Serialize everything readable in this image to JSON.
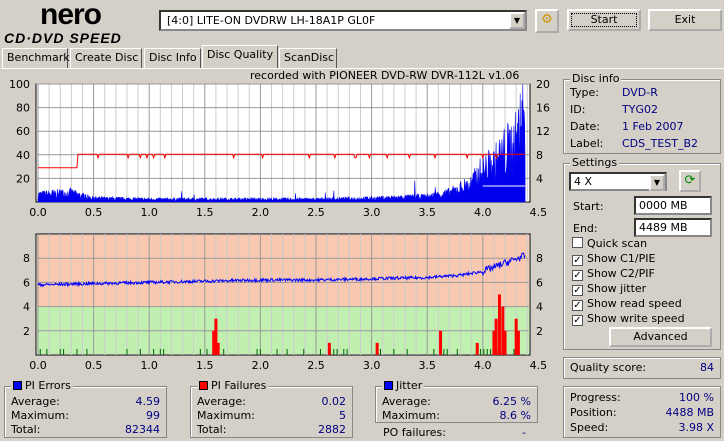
{
  "app": {
    "logo_top": "nero",
    "logo_bottom": "CD·DVD SPEED"
  },
  "toolbar": {
    "drive": "[4:0]  LITE-ON DVDRW LH-18A1P GL0F",
    "start": "Start",
    "exit": "Exit"
  },
  "tabs": [
    "Benchmark",
    "Create Disc",
    "Disc Info",
    "Disc Quality",
    "ScanDisc"
  ],
  "active_tab": "Disc Quality",
  "chart_title": "recorded with PIONEER DVD-RW  DVR-112L v1.06",
  "disc_info": {
    "title": "Disc info",
    "type_label": "Type:",
    "type": "DVD-R",
    "id_label": "ID:",
    "id": "TYG02",
    "date_label": "Date:",
    "date": "1 Feb 2007",
    "label_label": "Label:",
    "label": "CDS_TEST_B2"
  },
  "settings": {
    "title": "Settings",
    "speed": "4 X",
    "start_label": "Start:",
    "start": "0000 MB",
    "end_label": "End:",
    "end": "4489 MB",
    "checks": [
      {
        "label": "Quick scan",
        "checked": false
      },
      {
        "label": "Show C1/PIE",
        "checked": true
      },
      {
        "label": "Show C2/PIF",
        "checked": true
      },
      {
        "label": "Show jitter",
        "checked": true
      },
      {
        "label": "Show read speed",
        "checked": true
      },
      {
        "label": "Show write speed",
        "checked": true
      }
    ],
    "advanced": "Advanced"
  },
  "quality": {
    "label": "Quality score:",
    "value": "84"
  },
  "progress": {
    "progress_label": "Progress:",
    "progress": "100 %",
    "position_label": "Position:",
    "position": "4488 MB",
    "speed_label": "Speed:",
    "speed": "3.98 X"
  },
  "pi_errors": {
    "title": "PI Errors",
    "color": "#0000ff",
    "avg_label": "Average:",
    "avg": "4.59",
    "max_label": "Maximum:",
    "max": "99",
    "total_label": "Total:",
    "total": "82344"
  },
  "pi_failures": {
    "title": "PI Failures",
    "color": "#ff0000",
    "avg_label": "Average:",
    "avg": "0.02",
    "max_label": "Maximum:",
    "max": "5",
    "total_label": "Total:",
    "total": "2882"
  },
  "jitter": {
    "title": "Jitter",
    "color": "#0000ff",
    "avg_label": "Average:",
    "avg": "6.25 %",
    "max_label": "Maximum:",
    "max": "8.6 %",
    "po_label": "PO failures:",
    "po": "-"
  },
  "chart_data": [
    {
      "type": "area",
      "name": "PI errors / read speed",
      "x_ticks": [
        "0.0",
        "0.5",
        "1.0",
        "1.5",
        "2.0",
        "2.5",
        "3.0",
        "3.5",
        "4.0",
        "4.5"
      ],
      "y_left_ticks": [
        "100",
        "80",
        "60",
        "40",
        "20"
      ],
      "y_right_ticks": [
        "20",
        "16",
        "12",
        "8",
        "4"
      ],
      "xlim": [
        0,
        4.5
      ],
      "ylim": [
        0,
        100
      ],
      "y2lim": [
        0,
        20
      ],
      "pi_x": [
        0,
        0.3,
        0.35,
        0.5,
        1.0,
        1.5,
        2.0,
        2.5,
        3.0,
        3.5,
        3.7,
        3.9,
        4.0,
        4.1,
        4.2,
        4.3,
        4.35,
        4.38
      ],
      "pi_y": [
        8,
        10,
        8,
        4,
        3,
        3,
        3,
        3,
        4,
        6,
        10,
        20,
        35,
        40,
        55,
        65,
        85,
        99
      ],
      "read_speed_x": [
        0,
        0.35,
        0.36,
        4.3,
        4.38
      ],
      "read_speed_y": [
        5.8,
        5.8,
        8.1,
        8.1,
        8.1
      ]
    },
    {
      "type": "bar+line",
      "name": "PI failures / jitter",
      "x_ticks": [
        "0.0",
        "0.5",
        "1.0",
        "1.5",
        "2.0",
        "2.5",
        "3.0",
        "3.5",
        "4.0",
        "4.5"
      ],
      "y_left_ticks": [
        "8",
        "6",
        "4",
        "2"
      ],
      "y_right_ticks": [
        "8",
        "6",
        "4",
        "2"
      ],
      "xlim": [
        0,
        4.5
      ],
      "ylim": [
        0,
        10
      ],
      "jitter_x": [
        0,
        0.5,
        1.0,
        1.5,
        2.0,
        2.5,
        3.0,
        3.5,
        3.8,
        4.0,
        4.2,
        4.38
      ],
      "jitter_y": [
        5.8,
        5.9,
        6.0,
        6.1,
        6.2,
        6.2,
        6.3,
        6.4,
        6.6,
        6.9,
        7.6,
        8.2
      ],
      "pif_x": [
        1.58,
        1.6,
        1.62,
        2.62,
        3.05,
        3.62,
        3.95,
        4.1,
        4.12,
        4.15,
        4.18,
        4.2,
        4.3,
        4.32
      ],
      "pif_y": [
        2,
        3,
        1,
        1,
        1,
        2,
        1,
        2,
        3,
        5,
        4,
        2,
        3,
        2
      ]
    }
  ]
}
